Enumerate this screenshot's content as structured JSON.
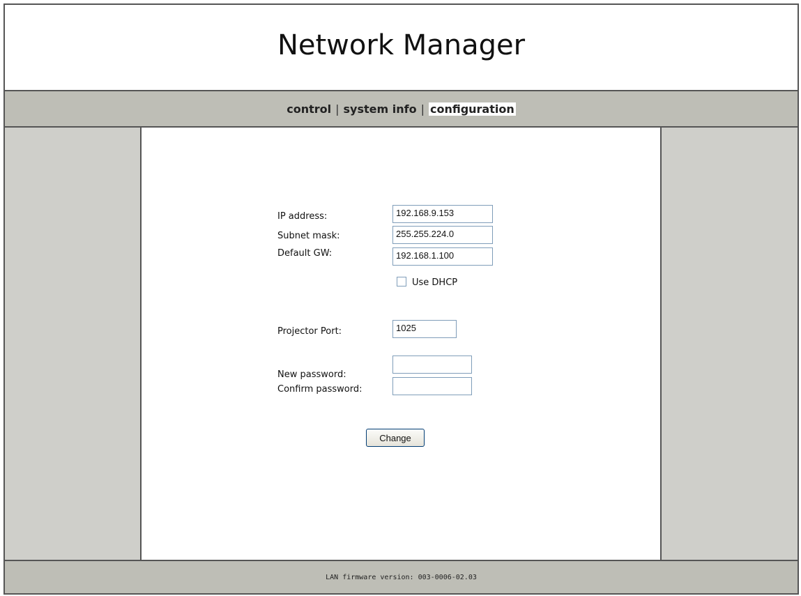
{
  "header": {
    "title": "Network Manager"
  },
  "nav": {
    "items": [
      {
        "label": "control"
      },
      {
        "label": "system info"
      },
      {
        "label": "configuration"
      }
    ],
    "separator": "|"
  },
  "form": {
    "ip": {
      "label": "IP address:",
      "value": "192.168.9.153"
    },
    "subnet": {
      "label": "Subnet mask:",
      "value": "255.255.224.0"
    },
    "gateway": {
      "label": "Default GW:",
      "value": "192.168.1.100"
    },
    "dhcp": {
      "label": "Use DHCP",
      "checked": false
    },
    "port": {
      "label": "Projector Port:",
      "value": "1025"
    },
    "new_password": {
      "label": "New password:",
      "value": ""
    },
    "confirm_password": {
      "label": "Confirm password:",
      "value": ""
    },
    "submit_label": "Change"
  },
  "footer": {
    "text": "LAN firmware version: 003-0006-02.03"
  }
}
